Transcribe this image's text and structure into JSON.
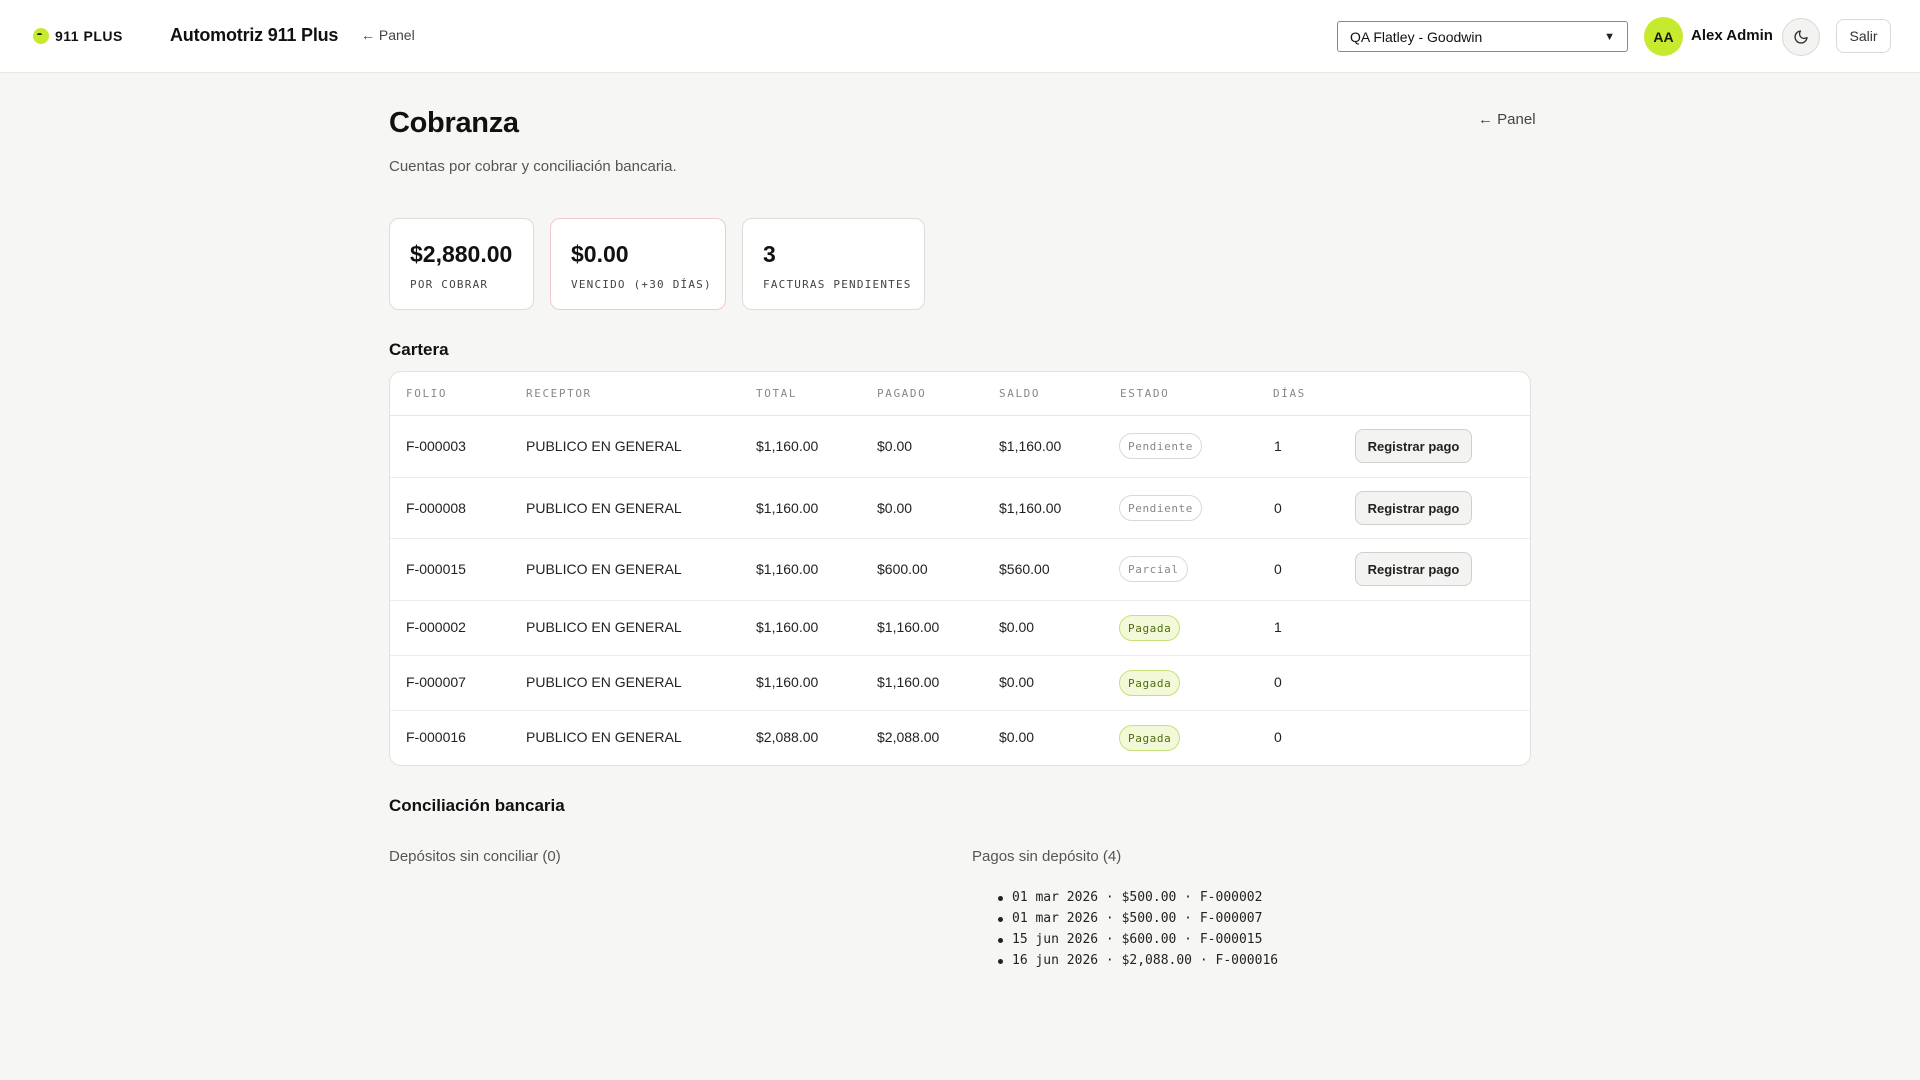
{
  "header": {
    "brand": "911 PLUS",
    "app_title": "Automotriz 911 Plus",
    "panel_link": "← Panel",
    "tenant_selected": "QA Flatley - Goodwin",
    "avatar_initials": "AA",
    "user_name": "Alex Admin",
    "theme_icon": "moon-icon",
    "logout_label": "Salir"
  },
  "page": {
    "title": "Cobranza",
    "panel_link": "← Panel",
    "subtitle": "Cuentas por cobrar y conciliación bancaria."
  },
  "kpis": [
    {
      "value": "$2,880.00",
      "label": "POR COBRAR"
    },
    {
      "value": "$0.00",
      "label": "VENCIDO (+30 DÍAS)"
    },
    {
      "value": "3",
      "label": "FACTURAS PENDIENTES"
    }
  ],
  "portfolio": {
    "title": "Cartera",
    "columns": [
      "FOLIO",
      "RECEPTOR",
      "TOTAL",
      "PAGADO",
      "SALDO",
      "ESTADO",
      "DÍAS"
    ],
    "rows": [
      {
        "folio": "F-000003",
        "receptor": "PUBLICO EN GENERAL",
        "total": "$1,160.00",
        "pagado": "$0.00",
        "saldo": "$1,160.00",
        "estado": "Pendiente",
        "dias": "1",
        "action": "Registrar pago"
      },
      {
        "folio": "F-000008",
        "receptor": "PUBLICO EN GENERAL",
        "total": "$1,160.00",
        "pagado": "$0.00",
        "saldo": "$1,160.00",
        "estado": "Pendiente",
        "dias": "0",
        "action": "Registrar pago"
      },
      {
        "folio": "F-000015",
        "receptor": "PUBLICO EN GENERAL",
        "total": "$1,160.00",
        "pagado": "$600.00",
        "saldo": "$560.00",
        "estado": "Parcial",
        "dias": "0",
        "action": "Registrar pago"
      },
      {
        "folio": "F-000002",
        "receptor": "PUBLICO EN GENERAL",
        "total": "$1,160.00",
        "pagado": "$1,160.00",
        "saldo": "$0.00",
        "estado": "Pagada",
        "dias": "1",
        "action": ""
      },
      {
        "folio": "F-000007",
        "receptor": "PUBLICO EN GENERAL",
        "total": "$1,160.00",
        "pagado": "$1,160.00",
        "saldo": "$0.00",
        "estado": "Pagada",
        "dias": "0",
        "action": ""
      },
      {
        "folio": "F-000016",
        "receptor": "PUBLICO EN GENERAL",
        "total": "$2,088.00",
        "pagado": "$2,088.00",
        "saldo": "$0.00",
        "estado": "Pagada",
        "dias": "0",
        "action": ""
      }
    ]
  },
  "reconciliation": {
    "title": "Conciliación bancaria",
    "unreconciled_deposits": "Depósitos sin conciliar (0)",
    "payments_without_deposit": "Pagos sin depósito (4)",
    "payments": [
      "01 mar 2026 · $500.00 · F-000002",
      "01 mar 2026 · $500.00 · F-000007",
      "15 jun 2026 · $600.00 · F-000015",
      "16 jun 2026 · $2,088.00 · F-000016"
    ]
  }
}
